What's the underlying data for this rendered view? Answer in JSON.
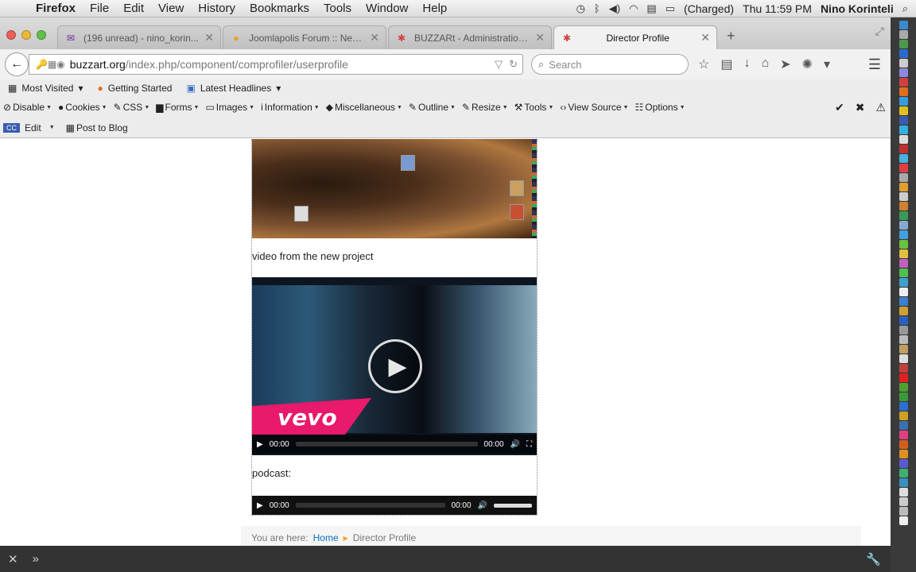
{
  "menubar": {
    "app": "Firefox",
    "items": [
      "File",
      "Edit",
      "View",
      "History",
      "Bookmarks",
      "Tools",
      "Window",
      "Help"
    ],
    "battery": "(Charged)",
    "clock": "Thu 11:59 PM",
    "user": "Nino Korinteli"
  },
  "tabs": [
    {
      "title": "(196 unread) - nino_korin...",
      "color": "#6a2a9a"
    },
    {
      "title": "Joomlapolis Forum :: New ...",
      "color": "#f0a020"
    },
    {
      "title": "BUZZARt - Administration...",
      "color": "#d04040"
    },
    {
      "title": "Director Profile",
      "color": "#d04040"
    }
  ],
  "nav": {
    "url_domain": "buzzart.org",
    "url_path": "/index.php/component/comprofiler/userprofile",
    "search_placeholder": "Search"
  },
  "bookmarks": [
    "Most Visited",
    "Getting Started",
    "Latest Headlines"
  ],
  "devtools": [
    "Disable",
    "Cookies",
    "CSS",
    "Forms",
    "Images",
    "Information",
    "Miscellaneous",
    "Outline",
    "Resize",
    "Tools",
    "View Source",
    "Options"
  ],
  "blogbar": {
    "edit": "Edit",
    "post": "Post to Blog"
  },
  "content": {
    "video_caption": "video from the new project",
    "video_brand": "vevo",
    "video_time_current": "00:00",
    "video_time_total": "00:00",
    "podcast_caption": "podcast:",
    "audio_time_current": "00:00",
    "audio_time_total": "00:00"
  },
  "breadcrumb": {
    "prefix": "You are here:",
    "home": "Home",
    "current": "Director Profile"
  },
  "colors": {
    "accent": "#0a6ec0",
    "vevo": "#e9196b"
  }
}
